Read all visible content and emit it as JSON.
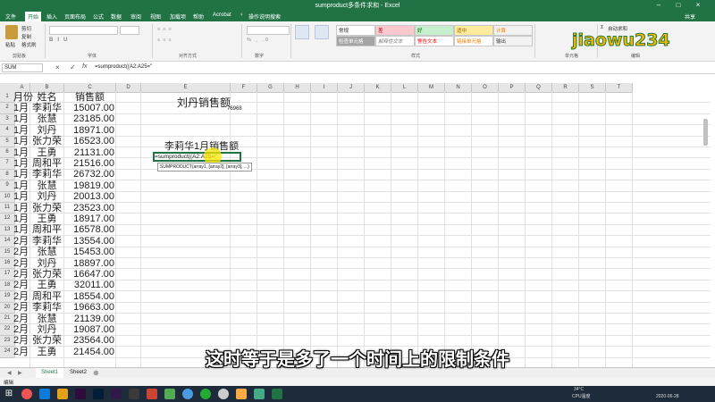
{
  "window": {
    "title": "sumproduct多条件求和 - Excel",
    "user": "共享"
  },
  "menu_tabs": [
    "文件",
    "开始",
    "插入",
    "页面布局",
    "公式",
    "数据",
    "审阅",
    "视图",
    "加载项",
    "帮助",
    "Acrobat"
  ],
  "tell_me": "操作说明搜索",
  "ribbon": {
    "paste": "粘贴",
    "cut": "剪切",
    "copy": "复制",
    "format_painter": "格式刷",
    "groups": [
      "剪贴板",
      "字体",
      "对齐方式",
      "数字",
      "样式",
      "单元格",
      "编辑"
    ],
    "styles": [
      "常规",
      "差",
      "好",
      "适中",
      "计算",
      "检查单元格",
      "解释性文本",
      "警告文本",
      "链接单元格",
      "输出"
    ],
    "autosum": "自动求和"
  },
  "formula_bar": {
    "name_box": "SUM",
    "formula": "=sumproduct((A2:A25=\""
  },
  "columns": [
    "A",
    "B",
    "C",
    "D",
    "E",
    "F",
    "G",
    "H",
    "I",
    "J",
    "K",
    "L",
    "M",
    "N",
    "O",
    "P",
    "Q",
    "R",
    "S",
    "T"
  ],
  "rows": [
    [
      "月份",
      "姓名",
      "销售额"
    ],
    [
      "1月",
      "李莉华",
      "15007.00"
    ],
    [
      "1月",
      "张慧",
      "23185.00"
    ],
    [
      "1月",
      "刘丹",
      "18971.00"
    ],
    [
      "1月",
      "张力荣",
      "16523.00"
    ],
    [
      "1月",
      "王勇",
      "21131.00"
    ],
    [
      "1月",
      "周和平",
      "21516.00"
    ],
    [
      "1月",
      "李莉华",
      "26732.00"
    ],
    [
      "1月",
      "张慧",
      "19819.00"
    ],
    [
      "1月",
      "刘丹",
      "20013.00"
    ],
    [
      "1月",
      "张力荣",
      "23523.00"
    ],
    [
      "1月",
      "王勇",
      "18917.00"
    ],
    [
      "1月",
      "周和平",
      "16578.00"
    ],
    [
      "2月",
      "李莉华",
      "13554.00"
    ],
    [
      "2月",
      "张慧",
      "15453.00"
    ],
    [
      "2月",
      "刘丹",
      "18897.00"
    ],
    [
      "2月",
      "张力荣",
      "16647.00"
    ],
    [
      "2月",
      "王勇",
      "32011.00"
    ],
    [
      "2月",
      "周和平",
      "18554.00"
    ],
    [
      "2月",
      "李莉华",
      "19663.00"
    ],
    [
      "2月",
      "张慧",
      "21139.00"
    ],
    [
      "2月",
      "刘丹",
      "19087.00"
    ],
    [
      "2月",
      "张力荣",
      "23564.00"
    ],
    [
      "2月",
      "王勇",
      "21454.00"
    ]
  ],
  "row_numbers": [
    "1",
    "2",
    "3",
    "4",
    "5",
    "6",
    "7",
    "8",
    "9",
    "10",
    "11",
    "12",
    "13",
    "14",
    "15",
    "16",
    "17",
    "18",
    "19",
    "20",
    "21",
    "22",
    "23",
    "24"
  ],
  "side": {
    "title1": "刘丹销售额",
    "value1": "76968",
    "title2": "李莉华1月销售额",
    "editing": "=sumproduct((A2:A25=\"",
    "tooltip": "SUMPRODUCT(array1, [array2], [array3], ...)"
  },
  "sheets": [
    "Sheet1",
    "Sheet2"
  ],
  "status": {
    "mode": "编辑"
  },
  "tray": {
    "temp": "34°C",
    "cpu": "CPU温度",
    "date": "2020-06-28"
  },
  "subtitle": "这时等于是多了一个时间上的限制条件",
  "watermark": "jiaowu234",
  "colors": {
    "excel_green": "#217346",
    "selection": "#217346",
    "taskbar": "#1d2b3a"
  }
}
